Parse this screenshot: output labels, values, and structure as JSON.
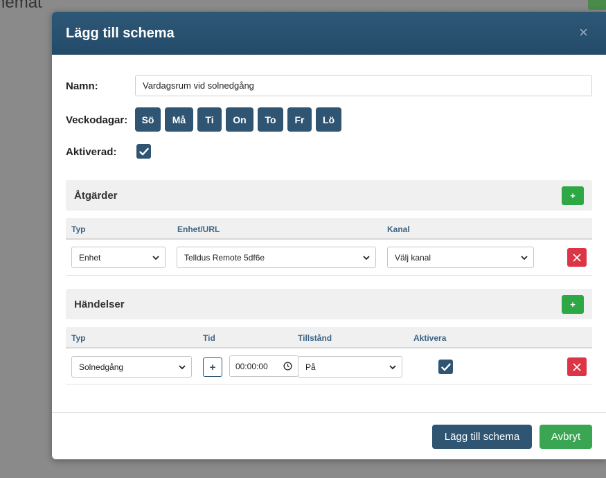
{
  "background": {
    "title_fragment": "hemat"
  },
  "modal": {
    "title": "Lägg till schema",
    "close_label": "×",
    "name": {
      "label": "Namn:",
      "value": "Vardagsrum vid solnedgång"
    },
    "weekdays": {
      "label": "Veckodagar:",
      "days": [
        "Sö",
        "Må",
        "Ti",
        "On",
        "To",
        "Fr",
        "Lö"
      ]
    },
    "active": {
      "label": "Aktiverad:",
      "checked": true
    },
    "actions": {
      "title": "Åtgärder",
      "add_label": "+",
      "columns": [
        "Typ",
        "Enhet/URL",
        "Kanal"
      ],
      "rows": [
        {
          "type": "Enhet",
          "device": "Telldus Remote 5df6e",
          "channel": "Välj kanal"
        }
      ]
    },
    "events": {
      "title": "Händelser",
      "add_label": "+",
      "columns": [
        "Typ",
        "Tid",
        "Tillstånd",
        "Aktivera"
      ],
      "rows": [
        {
          "type": "Solnedgång",
          "offset_label": "+",
          "time": "00:00:00",
          "state": "På",
          "activate": true
        }
      ]
    },
    "footer": {
      "submit_label": "Lägg till schema",
      "cancel_label": "Avbryt"
    }
  },
  "colors": {
    "header": "#2e5877",
    "primary": "#2f5572",
    "success": "#2ea844",
    "danger": "#dc3545"
  }
}
